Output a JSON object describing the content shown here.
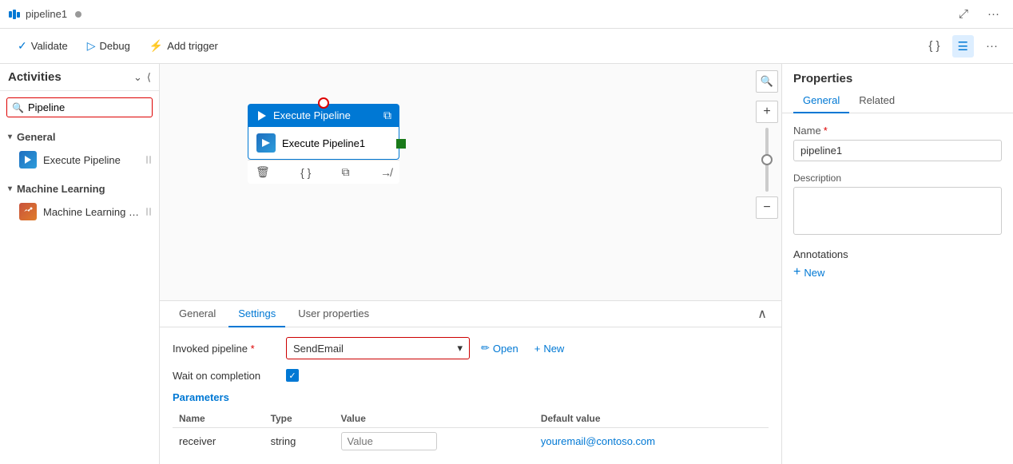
{
  "topbar": {
    "title": "pipeline1",
    "dot_indicator": "●"
  },
  "toolbar": {
    "validate_label": "Validate",
    "debug_label": "Debug",
    "add_trigger_label": "Add trigger"
  },
  "sidebar": {
    "title": "Activities",
    "search_placeholder": "Pipeline",
    "general_section": "General",
    "general_items": [
      {
        "label": "Execute Pipeline",
        "icon": "execute-pipeline-icon"
      }
    ],
    "ml_section": "Machine Learning",
    "ml_items": [
      {
        "label": "Machine Learning Exe...",
        "icon": "ml-icon"
      }
    ]
  },
  "canvas": {
    "node_title": "Execute Pipeline",
    "node_label": "Execute Pipeline1"
  },
  "bottom_panel": {
    "tabs": [
      {
        "label": "General",
        "active": false
      },
      {
        "label": "Settings",
        "active": true
      },
      {
        "label": "User properties",
        "active": false
      }
    ],
    "invoked_pipeline_label": "Invoked pipeline",
    "required_marker": "*",
    "pipeline_value": "SendEmail",
    "open_label": "Open",
    "new_label": "New",
    "wait_on_completion_label": "Wait on completion",
    "parameters_title": "Parameters",
    "params_headers": [
      "Name",
      "Type",
      "Value",
      "Default value"
    ],
    "params_rows": [
      {
        "name": "receiver",
        "type": "string",
        "value_placeholder": "Value",
        "default_value": "youremail@contoso.com"
      }
    ]
  },
  "right_panel": {
    "title": "Properties",
    "tabs": [
      {
        "label": "General",
        "active": true
      },
      {
        "label": "Related",
        "active": false
      }
    ],
    "name_label": "Name",
    "name_required": "*",
    "name_value": "pipeline1",
    "description_label": "Description",
    "description_value": "",
    "annotations_label": "Annotations",
    "new_annotation_label": "New"
  }
}
